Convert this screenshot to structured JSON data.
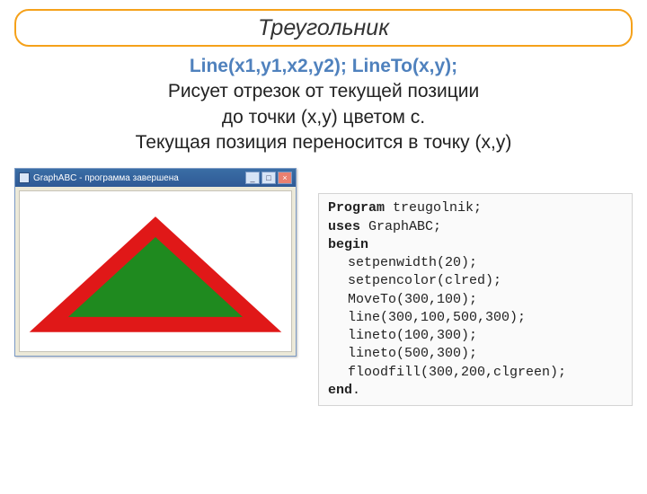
{
  "title": "Треугольник",
  "desc": {
    "cmd": "Line(x1,y1,x2,y2); LineTo(x,y);",
    "l1": "Рисует отрезок от текущей позиции",
    "l2": "до точки (x,y) цветом c.",
    "l3": "Текущая позиция переносится в точку (x,y)"
  },
  "window": {
    "title": "GraphABC - программа завершена",
    "min": "_",
    "max": "□",
    "close": "×"
  },
  "code": {
    "l1a": "Program",
    "l1b": " treugolnik;",
    "l2a": "uses",
    "l2b": " GraphABC;",
    "l3": "begin",
    "l4": "setpenwidth(20);",
    "l5": "setpencolor(clred);",
    "l6": "MoveTo(300,100);",
    "l7": "line(300,100,500,300);",
    "l8": "lineto(100,300);",
    "l9": "lineto(500,300);",
    "l10": "floodfill(300,200,clgreen);",
    "l11a": "end",
    "l11b": "."
  }
}
